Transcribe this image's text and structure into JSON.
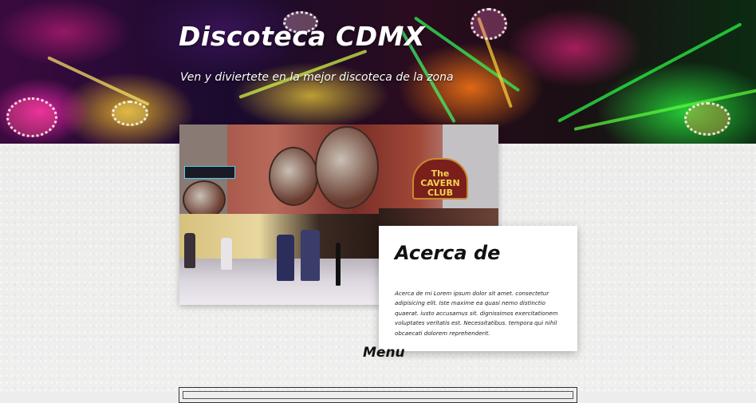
{
  "header": {
    "title": "Discoteca CDMX",
    "tagline": "Ven y diviertete en la mejor discoteca de la zona"
  },
  "hero_photo": {
    "club_sign": "The CAVERN CLUB"
  },
  "about": {
    "heading": "Acerca de",
    "body": "Acerca de mi Lorem ipsum dolor sit amet. consectetur adipisicing elit. Iste maxime ea quasi nemo distinctio quaerat. iusto accusamus sit. dignissimos exercitationem voluptates veritatis est. Necessitatibus. tempora qui nihil obcaecati dolorem reprehenderit."
  },
  "menu": {
    "heading": "Menu"
  }
}
